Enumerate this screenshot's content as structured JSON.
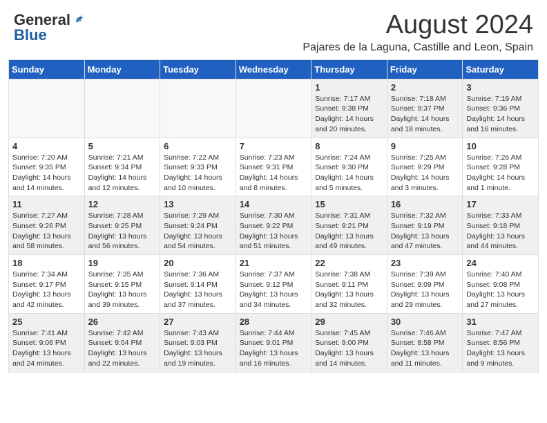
{
  "header": {
    "logo_general": "General",
    "logo_blue": "Blue",
    "month_year": "August 2024",
    "location": "Pajares de la Laguna, Castille and Leon, Spain"
  },
  "days_of_week": [
    "Sunday",
    "Monday",
    "Tuesday",
    "Wednesday",
    "Thursday",
    "Friday",
    "Saturday"
  ],
  "weeks": [
    [
      {
        "day": "",
        "info": "",
        "empty": true
      },
      {
        "day": "",
        "info": "",
        "empty": true
      },
      {
        "day": "",
        "info": "",
        "empty": true
      },
      {
        "day": "",
        "info": "",
        "empty": true
      },
      {
        "day": "1",
        "info": "Sunrise: 7:17 AM\nSunset: 9:38 PM\nDaylight: 14 hours and 20 minutes."
      },
      {
        "day": "2",
        "info": "Sunrise: 7:18 AM\nSunset: 9:37 PM\nDaylight: 14 hours and 18 minutes."
      },
      {
        "day": "3",
        "info": "Sunrise: 7:19 AM\nSunset: 9:36 PM\nDaylight: 14 hours and 16 minutes."
      }
    ],
    [
      {
        "day": "4",
        "info": "Sunrise: 7:20 AM\nSunset: 9:35 PM\nDaylight: 14 hours and 14 minutes."
      },
      {
        "day": "5",
        "info": "Sunrise: 7:21 AM\nSunset: 9:34 PM\nDaylight: 14 hours and 12 minutes."
      },
      {
        "day": "6",
        "info": "Sunrise: 7:22 AM\nSunset: 9:33 PM\nDaylight: 14 hours and 10 minutes."
      },
      {
        "day": "7",
        "info": "Sunrise: 7:23 AM\nSunset: 9:31 PM\nDaylight: 14 hours and 8 minutes."
      },
      {
        "day": "8",
        "info": "Sunrise: 7:24 AM\nSunset: 9:30 PM\nDaylight: 14 hours and 5 minutes."
      },
      {
        "day": "9",
        "info": "Sunrise: 7:25 AM\nSunset: 9:29 PM\nDaylight: 14 hours and 3 minutes."
      },
      {
        "day": "10",
        "info": "Sunrise: 7:26 AM\nSunset: 9:28 PM\nDaylight: 14 hours and 1 minute."
      }
    ],
    [
      {
        "day": "11",
        "info": "Sunrise: 7:27 AM\nSunset: 9:26 PM\nDaylight: 13 hours and 58 minutes."
      },
      {
        "day": "12",
        "info": "Sunrise: 7:28 AM\nSunset: 9:25 PM\nDaylight: 13 hours and 56 minutes."
      },
      {
        "day": "13",
        "info": "Sunrise: 7:29 AM\nSunset: 9:24 PM\nDaylight: 13 hours and 54 minutes."
      },
      {
        "day": "14",
        "info": "Sunrise: 7:30 AM\nSunset: 9:22 PM\nDaylight: 13 hours and 51 minutes."
      },
      {
        "day": "15",
        "info": "Sunrise: 7:31 AM\nSunset: 9:21 PM\nDaylight: 13 hours and 49 minutes."
      },
      {
        "day": "16",
        "info": "Sunrise: 7:32 AM\nSunset: 9:19 PM\nDaylight: 13 hours and 47 minutes."
      },
      {
        "day": "17",
        "info": "Sunrise: 7:33 AM\nSunset: 9:18 PM\nDaylight: 13 hours and 44 minutes."
      }
    ],
    [
      {
        "day": "18",
        "info": "Sunrise: 7:34 AM\nSunset: 9:17 PM\nDaylight: 13 hours and 42 minutes."
      },
      {
        "day": "19",
        "info": "Sunrise: 7:35 AM\nSunset: 9:15 PM\nDaylight: 13 hours and 39 minutes."
      },
      {
        "day": "20",
        "info": "Sunrise: 7:36 AM\nSunset: 9:14 PM\nDaylight: 13 hours and 37 minutes."
      },
      {
        "day": "21",
        "info": "Sunrise: 7:37 AM\nSunset: 9:12 PM\nDaylight: 13 hours and 34 minutes."
      },
      {
        "day": "22",
        "info": "Sunrise: 7:38 AM\nSunset: 9:11 PM\nDaylight: 13 hours and 32 minutes."
      },
      {
        "day": "23",
        "info": "Sunrise: 7:39 AM\nSunset: 9:09 PM\nDaylight: 13 hours and 29 minutes."
      },
      {
        "day": "24",
        "info": "Sunrise: 7:40 AM\nSunset: 9:08 PM\nDaylight: 13 hours and 27 minutes."
      }
    ],
    [
      {
        "day": "25",
        "info": "Sunrise: 7:41 AM\nSunset: 9:06 PM\nDaylight: 13 hours and 24 minutes."
      },
      {
        "day": "26",
        "info": "Sunrise: 7:42 AM\nSunset: 9:04 PM\nDaylight: 13 hours and 22 minutes."
      },
      {
        "day": "27",
        "info": "Sunrise: 7:43 AM\nSunset: 9:03 PM\nDaylight: 13 hours and 19 minutes."
      },
      {
        "day": "28",
        "info": "Sunrise: 7:44 AM\nSunset: 9:01 PM\nDaylight: 13 hours and 16 minutes."
      },
      {
        "day": "29",
        "info": "Sunrise: 7:45 AM\nSunset: 9:00 PM\nDaylight: 13 hours and 14 minutes."
      },
      {
        "day": "30",
        "info": "Sunrise: 7:46 AM\nSunset: 8:58 PM\nDaylight: 13 hours and 11 minutes."
      },
      {
        "day": "31",
        "info": "Sunrise: 7:47 AM\nSunset: 8:56 PM\nDaylight: 13 hours and 9 minutes."
      }
    ]
  ]
}
